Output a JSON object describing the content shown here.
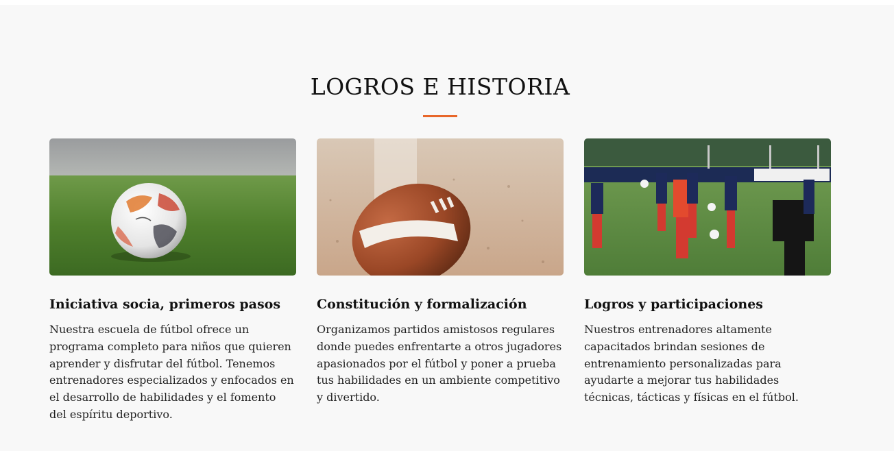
{
  "section": {
    "title": "LOGROS E HISTORIA",
    "accent_color": "#e8672a"
  },
  "cards": [
    {
      "image": "soccer-ball-on-grass",
      "title": "Iniciativa socia, primeros pasos",
      "text": "Nuestra escuela de fútbol ofrece un programa completo para niños que quieren aprender y disfrutar del fútbol. Tenemos entrenadores especializados y enfocados en el desarrollo de habilidades y el fomento del espíritu deportivo."
    },
    {
      "image": "american-football-on-field",
      "title": "Constitución y formalización",
      "text": "Organizamos partidos amistosos regulares donde puedes enfrentarte a otros jugadores apasionados por el fútbol y poner a prueba tus habilidades en un ambiente competitivo y divertido."
    },
    {
      "image": "team-training-session",
      "title": "Logros y participaciones",
      "text": "Nuestros entrenadores altamente capacitados brindan sesiones de entrenamiento personalizadas para ayudarte a mejorar tus habilidades técnicas, tácticas y físicas en el fútbol."
    }
  ]
}
